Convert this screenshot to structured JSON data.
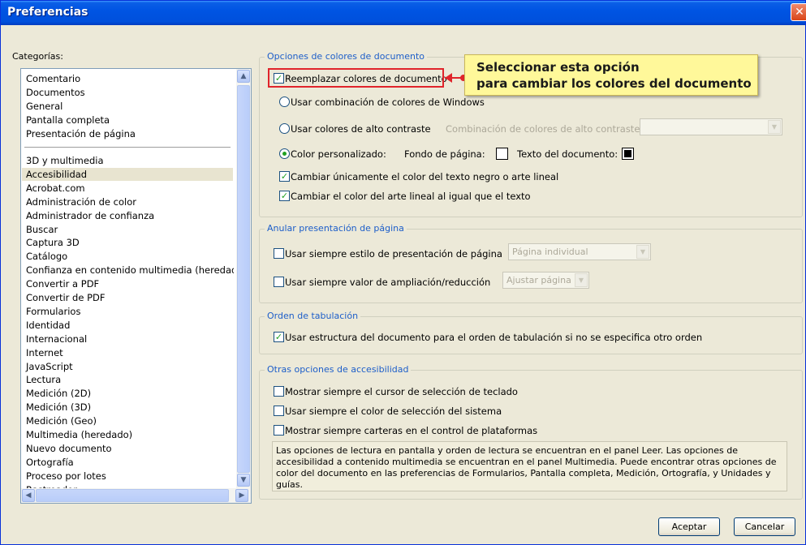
{
  "window": {
    "title": "Preferencias",
    "close_glyph": "✕"
  },
  "categories": {
    "label": "Categorías:",
    "group1": [
      "Comentario",
      "Documentos",
      "General",
      "Pantalla completa",
      "Presentación de página"
    ],
    "group2": [
      "3D y multimedia",
      "Accesibilidad",
      "Acrobat.com",
      "Administración de color",
      "Administrador de confianza",
      "Buscar",
      "Captura 3D",
      "Catálogo",
      "Confianza en contenido multimedia (heredado)",
      "Convertir a PDF",
      "Convertir de PDF",
      "Formularios",
      "Identidad",
      "Internacional",
      "Internet",
      "JavaScript",
      "Lectura",
      "Medición (2D)",
      "Medición (3D)",
      "Medición (Geo)",
      "Multimedia (heredado)",
      "Nuevo documento",
      "Ortografía",
      "Proceso por lotes",
      "Rastreador"
    ],
    "selected": "Accesibilidad"
  },
  "doc_colors": {
    "title": "Opciones de colores de documento",
    "replace_colors": "Reemplazar colores de documento",
    "use_windows": "Usar combinación de colores de Windows",
    "high_contrast": "Usar colores de alto contraste",
    "high_contrast_combo_label": "Combinación de colores de alto contraste:",
    "custom": "Color personalizado:",
    "page_bg": "Fondo de página:",
    "doc_text": "Texto del documento:",
    "only_black": "Cambiar únicamente el color del texto negro o arte lineal",
    "line_art": "Cambiar el color del arte lineal al igual que el texto"
  },
  "page_display": {
    "title": "Anular presentación de página",
    "always_layout": "Usar siempre estilo de presentación de página",
    "layout_value": "Página individual",
    "always_zoom": "Usar siempre valor de ampliación/reducción",
    "zoom_value": "Ajustar página"
  },
  "tab_order": {
    "title": "Orden de tabulación",
    "use_structure": "Usar estructura del documento para el orden de tabulación si no se especifica otro orden"
  },
  "other": {
    "title": "Otras opciones de accesibilidad",
    "keyboard_cursor": "Mostrar siempre el cursor de selección de teclado",
    "system_color": "Usar siempre el color de selección del sistema",
    "portfolio": "Mostrar siempre carteras en el control de plataformas",
    "info_text": "Las opciones de lectura en pantalla y orden de lectura se encuentran en el panel Leer. Las opciones de accesibilidad a contenido multimedia se encuentran en el panel Multimedia. Puede encontrar otras opciones de color del documento en las preferencias de Formularios, Pantalla completa, Medición, Ortografía, y Unidades y guías."
  },
  "buttons": {
    "ok": "Aceptar",
    "cancel": "Cancelar"
  },
  "callout": {
    "line1": "Seleccionar esta opción",
    "line2": "para cambiar los colores del documento"
  },
  "glyphs": {
    "check": "✓",
    "up": "▲",
    "down": "▼",
    "left": "◀",
    "right": "▶",
    "combo": "▼"
  }
}
